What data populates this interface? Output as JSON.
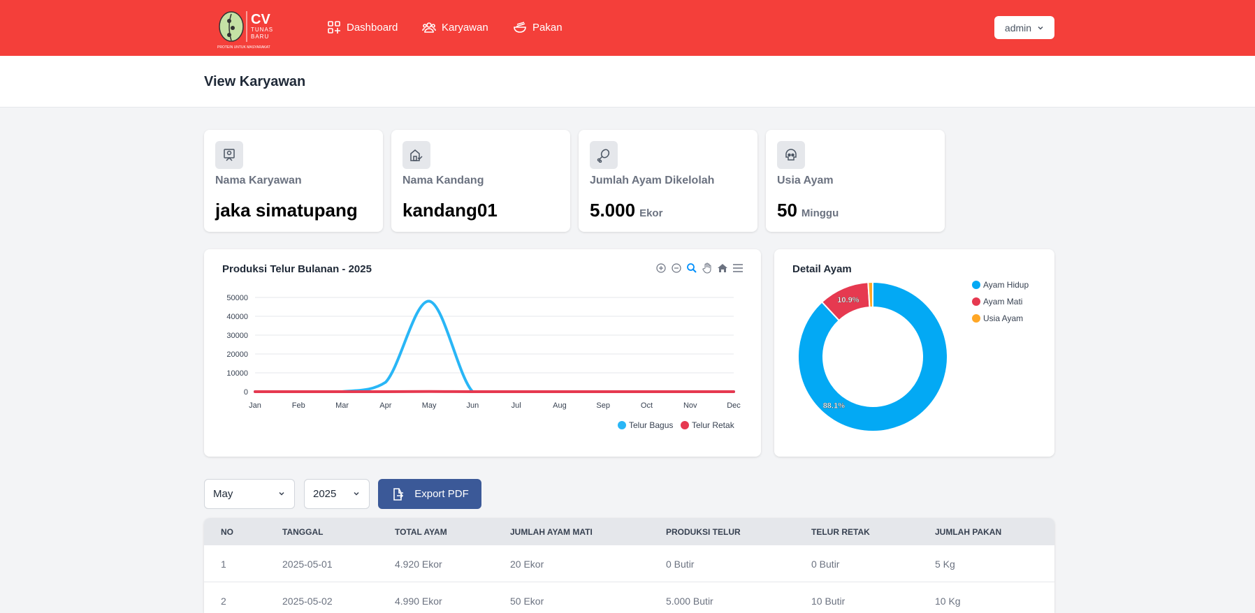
{
  "brand": {
    "line1": "CV",
    "line2": "TUNAS",
    "line3": "BARU",
    "tagline": "PROTEIN UNTUK MASYARAKAT"
  },
  "nav": [
    {
      "label": "Dashboard",
      "icon": "dashboard-icon"
    },
    {
      "label": "Karyawan",
      "icon": "users-icon"
    },
    {
      "label": "Pakan",
      "icon": "feed-bowl-icon"
    }
  ],
  "user": {
    "name": "admin"
  },
  "page": {
    "title": "View Karyawan"
  },
  "stats": [
    {
      "label": "Nama Karyawan",
      "value": "jaka simatupang",
      "unit": "",
      "icon": "employee-icon"
    },
    {
      "label": "Nama Kandang",
      "value": "kandang01",
      "unit": "",
      "icon": "coop-icon"
    },
    {
      "label": "Jumlah Ayam Dikelolah",
      "value": "5.000",
      "unit": "Ekor",
      "icon": "chicken-leg-icon"
    },
    {
      "label": "Usia Ayam",
      "value": "50",
      "unit": "Minggu",
      "icon": "skull-icon"
    }
  ],
  "line_chart_title": "Produksi Telur Bulanan - 2025",
  "donut_title": "Detail Ayam",
  "chart_data": [
    {
      "type": "line",
      "title": "Produksi Telur Bulanan - 2025",
      "categories": [
        "Jan",
        "Feb",
        "Mar",
        "Apr",
        "May",
        "Jun",
        "Jul",
        "Aug",
        "Sep",
        "Oct",
        "Nov",
        "Dec"
      ],
      "ylim": [
        0,
        50000
      ],
      "yticks": [
        "50000",
        "40000",
        "30000",
        "20000",
        "10000",
        "0"
      ],
      "grid": true,
      "legend": "bottom-right",
      "series": [
        {
          "name": "Telur Bagus",
          "color": "#29b6f6",
          "values": [
            0,
            0,
            0,
            5000,
            48000,
            0,
            0,
            0,
            0,
            0,
            0,
            0
          ]
        },
        {
          "name": "Telur Retak",
          "color": "#e63950",
          "values": [
            0,
            0,
            0,
            0,
            100,
            0,
            0,
            0,
            0,
            0,
            0,
            0
          ]
        }
      ]
    },
    {
      "type": "pie",
      "title": "Detail Ayam",
      "legend": "top-right",
      "labels": [
        "Ayam Hidup",
        "Ayam Mati",
        "Usia Ayam"
      ],
      "values": [
        88.1,
        10.9,
        1.0
      ],
      "colors": [
        "#03a9f4",
        "#e63950",
        "#ffa726"
      ],
      "data_labels": [
        "88.1%",
        "10.9%",
        ""
      ]
    }
  ],
  "filters": {
    "month": "May",
    "year": "2025"
  },
  "export_label": "Export PDF",
  "table": {
    "headers": [
      "NO",
      "TANGGAL",
      "TOTAL AYAM",
      "JUMLAH AYAM MATI",
      "PRODUKSI TELUR",
      "TELUR RETAK",
      "JUMLAH PAKAN"
    ],
    "rows": [
      [
        "1",
        "2025-05-01",
        "4.920 Ekor",
        "20 Ekor",
        "0 Butir",
        "0 Butir",
        "5 Kg"
      ],
      [
        "2",
        "2025-05-02",
        "4.990 Ekor",
        "50 Ekor",
        "5.000 Butir",
        "10 Butir",
        "10 Kg"
      ]
    ]
  }
}
